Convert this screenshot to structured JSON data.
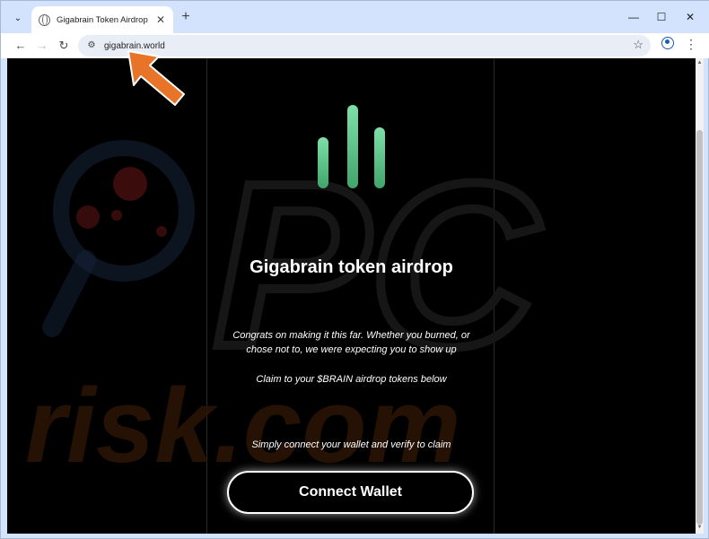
{
  "browser": {
    "tab_title": "Gigabrain Token Airdrop",
    "tab_close": "✕",
    "new_tab": "+",
    "minimize": "—",
    "maximize": "☐",
    "close": "✕",
    "url": "gigabrain.world"
  },
  "page": {
    "headline": "Gigabrain token airdrop",
    "congrats_line1": "Congrats on making it this far. Whether you burned, or",
    "congrats_line2": "chose not to, we were expecting you to show up",
    "claim_text": "Claim to your $BRAIN airdrop tokens below",
    "connect_prompt": "Simply connect your wallet and verify to claim",
    "connect_button": "Connect Wallet"
  },
  "watermark": {
    "text": "risk.com",
    "logo_text": "PC"
  },
  "colors": {
    "accent_green": "#5ccf8f",
    "annotation_orange": "#e8742a",
    "page_background": "#000000",
    "browser_chrome": "#d3e3fd"
  }
}
